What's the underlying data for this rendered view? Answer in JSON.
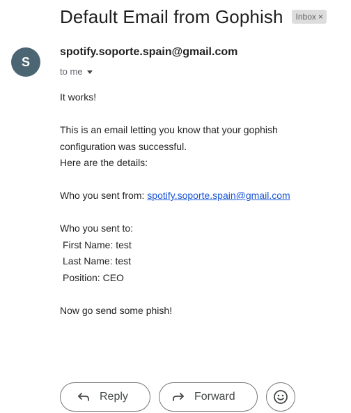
{
  "email": {
    "subject": "Default Email from Gophish",
    "label_chip": "Inbox",
    "label_chip_close": "×",
    "sender_initial": "S",
    "sender_email": "spotify.soporte.spain@gmail.com",
    "recipient_text": "to me"
  },
  "body": {
    "line1": "It works!",
    "line2": "This is an email letting you know that your gophish",
    "line3": "configuration was successful.",
    "line4": "Here are the details:",
    "from_prefix": "Who you sent from: ",
    "from_link": "spotify.soporte.spain@gmail.com",
    "to_heading": "Who you sent to:",
    "first_name": " First Name: test",
    "last_name": " Last Name: test",
    "position": " Position: CEO",
    "closing": "Now go send some phish!"
  },
  "actions": {
    "reply_label": "Reply",
    "forward_label": "Forward"
  },
  "colors": {
    "avatar_bg": "#4b6572",
    "link": "#1a55d5",
    "chip_bg": "#dddddd"
  },
  "icons": [
    "reply-arrow-icon",
    "forward-arrow-icon",
    "emoji-icon",
    "chevron-down-icon"
  ]
}
